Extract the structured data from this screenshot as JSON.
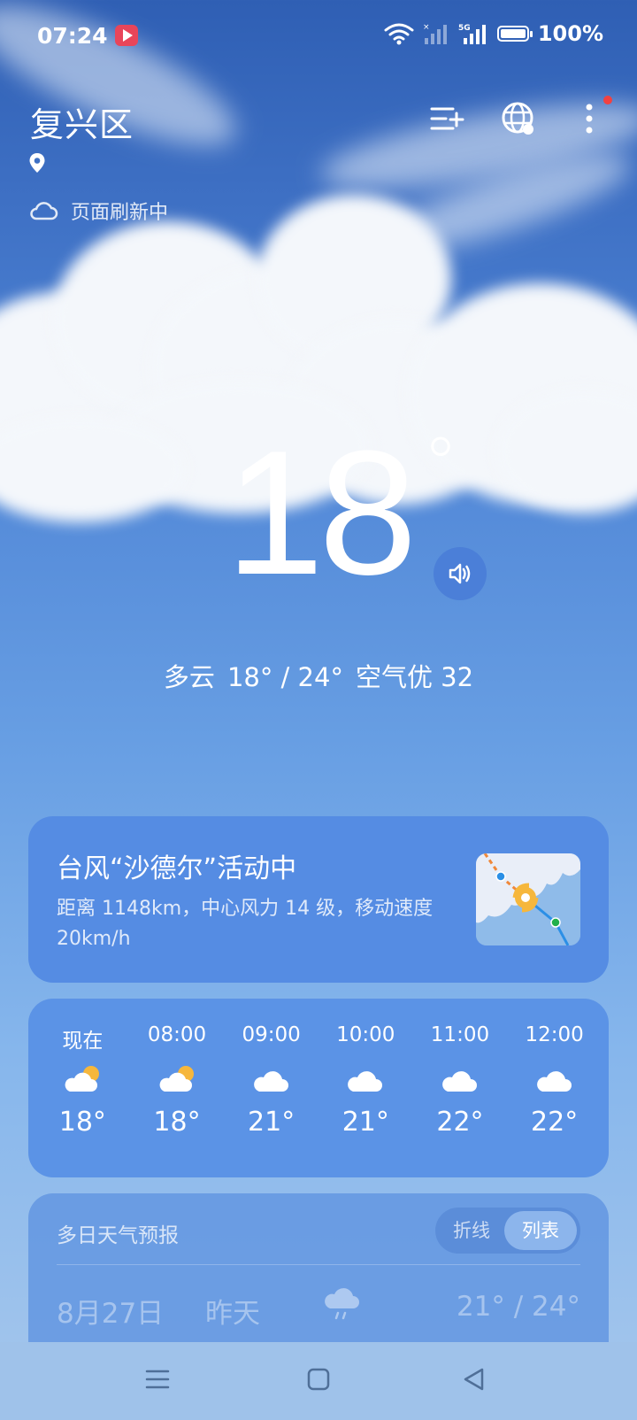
{
  "status_bar": {
    "time": "07:24",
    "network": "5G",
    "battery": "100%"
  },
  "header": {
    "city": "复兴区",
    "refresh_text": "页面刷新中"
  },
  "current": {
    "temperature": "18",
    "degree_symbol": "°",
    "condition": "多云",
    "range": "18° / 24°",
    "air_quality": "空气优 32"
  },
  "typhoon": {
    "title": "台风“沙德尔”活动中",
    "description": "距离 1148km，中心风力 14 级，移动速度 20km/h"
  },
  "hourly": [
    {
      "time": "现在",
      "icon": "partly-cloudy-sun",
      "temp": "18°"
    },
    {
      "time": "08:00",
      "icon": "partly-cloudy-sun",
      "temp": "18°"
    },
    {
      "time": "09:00",
      "icon": "cloudy",
      "temp": "21°"
    },
    {
      "time": "10:00",
      "icon": "cloudy",
      "temp": "21°"
    },
    {
      "time": "11:00",
      "icon": "cloudy",
      "temp": "22°"
    },
    {
      "time": "12:00",
      "icon": "cloudy",
      "temp": "22°"
    }
  ],
  "daily": {
    "title": "多日天气预报",
    "toggle": {
      "line": "折线",
      "list": "列表",
      "selected": "列表"
    },
    "rows": [
      {
        "date": "8月27日",
        "relative": "昨天",
        "icon": "rain-cloud",
        "range": "21° / 24°"
      }
    ]
  },
  "colors": {
    "sky_top": "#2f5fb4",
    "card_blue": "#558ce3",
    "sun_accent": "#f6b73c"
  }
}
